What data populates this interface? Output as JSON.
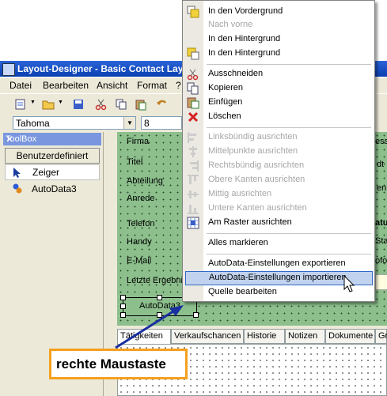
{
  "window": {
    "title": "Layout-Designer - Basic Contact Layo"
  },
  "menubar": {
    "items": [
      "Datei",
      "Bearbeiten",
      "Ansicht",
      "Format",
      "?"
    ]
  },
  "fontbar": {
    "font": "Tahoma",
    "size": "8"
  },
  "toolbox": {
    "title": "ToolBox",
    "close": "✕",
    "button": "Benutzerdefiniert",
    "tools": [
      {
        "label": "Zeiger",
        "icon": "pointer-icon"
      },
      {
        "label": "AutoData3",
        "icon": "autodata-icon"
      }
    ]
  },
  "form": {
    "labels": [
      "Firma",
      "Titel",
      "Abteilung",
      "Anrede",
      "Telefon",
      "Handy",
      "E-Mail",
      "Letzte Ergebni"
    ],
    "selected": "AutoData3",
    "right_fragments": [
      "ess",
      "dt",
      "en",
      "atu",
      "Sta",
      "ofo"
    ]
  },
  "tabs": [
    "Tätigkeiten",
    "Verkaufschancen",
    "Historie",
    "Notizen",
    "Dokumente",
    "Gr"
  ],
  "callout": {
    "text": "rechte Maustaste"
  },
  "context_menu": {
    "items": [
      {
        "label": "In den Vordergrund",
        "disabled": false,
        "icon": "bring-front-icon"
      },
      {
        "label": "Nach vorne",
        "disabled": true,
        "icon": ""
      },
      {
        "label": "In den Hintergrund",
        "disabled": false,
        "icon": ""
      },
      {
        "label": "In den Hintergrund",
        "disabled": false,
        "icon": "send-back-icon"
      },
      {
        "label": "Ausschneiden",
        "disabled": false,
        "icon": "cut-icon"
      },
      {
        "label": "Kopieren",
        "disabled": false,
        "icon": "copy-icon"
      },
      {
        "label": "Einfügen",
        "disabled": false,
        "icon": "paste-icon"
      },
      {
        "label": "Löschen",
        "disabled": false,
        "icon": "delete-icon"
      },
      {
        "label": "Linksbündig ausrichten",
        "disabled": true,
        "icon": "align-left-icon"
      },
      {
        "label": "Mittelpunkte ausrichten",
        "disabled": true,
        "icon": "align-center-icon"
      },
      {
        "label": "Rechtsbündig ausrichten",
        "disabled": true,
        "icon": "align-right-icon"
      },
      {
        "label": "Obere Kanten ausrichten",
        "disabled": true,
        "icon": "align-top-icon"
      },
      {
        "label": "Mittig ausrichten",
        "disabled": true,
        "icon": "align-middle-icon"
      },
      {
        "label": "Untere Kanten ausrichten",
        "disabled": true,
        "icon": "align-bottom-icon"
      },
      {
        "label": "Am Raster ausrichten",
        "disabled": false,
        "icon": "grid-icon"
      },
      {
        "label": "Alles markieren",
        "disabled": false,
        "icon": ""
      },
      {
        "label": "AutoData-Einstellungen exportieren",
        "disabled": false,
        "icon": ""
      },
      {
        "label": "AutoData-Einstellungen importieren",
        "disabled": false,
        "icon": "",
        "highlighted": true
      },
      {
        "label": "Quelle bearbeiten",
        "disabled": false,
        "icon": ""
      }
    ]
  }
}
